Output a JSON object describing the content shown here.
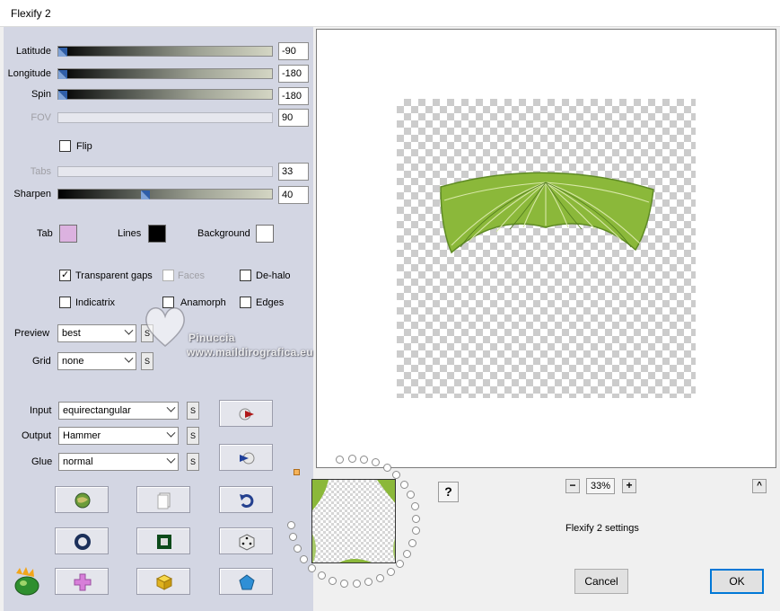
{
  "window": {
    "title": "Flexify 2"
  },
  "sliders": {
    "latitude": {
      "label": "Latitude",
      "value": "-90",
      "level": 0.0,
      "enabled": true
    },
    "longitude": {
      "label": "Longitude",
      "value": "-180",
      "level": 0.0,
      "enabled": true
    },
    "spin": {
      "label": "Spin",
      "value": "-180",
      "level": 0.0,
      "enabled": true
    },
    "fov": {
      "label": "FOV",
      "value": "90",
      "enabled": false
    },
    "tabs": {
      "label": "Tabs",
      "value": "33",
      "enabled": false
    },
    "sharpen": {
      "label": "Sharpen",
      "value": "40",
      "level": 0.4,
      "enabled": true
    }
  },
  "flip": {
    "label": "Flip",
    "checked": false
  },
  "colors": {
    "tab": {
      "label": "Tab",
      "color": "#dcb2e0"
    },
    "lines": {
      "label": "Lines",
      "color": "#000000"
    },
    "background": {
      "label": "Background",
      "color": "#ffffff"
    }
  },
  "options": {
    "transparent_gaps": {
      "label": "Transparent gaps",
      "checked": true,
      "enabled": true
    },
    "faces": {
      "label": "Faces",
      "checked": false,
      "enabled": false
    },
    "de_halo": {
      "label": "De-halo",
      "checked": false,
      "enabled": true
    },
    "indicatrix": {
      "label": "Indicatrix",
      "checked": false,
      "enabled": true
    },
    "anamorph": {
      "label": "Anamorph",
      "checked": false,
      "enabled": true
    },
    "edges": {
      "label": "Edges",
      "checked": false,
      "enabled": true
    }
  },
  "preview_select": {
    "label": "Preview",
    "value": "best",
    "s": "S"
  },
  "grid_select": {
    "label": "Grid",
    "value": "none",
    "s": "S"
  },
  "input_select": {
    "label": "Input",
    "value": "equirectangular",
    "s": "S"
  },
  "output_select": {
    "label": "Output",
    "value": "Hammer",
    "s": "S"
  },
  "glue_select": {
    "label": "Glue",
    "value": "normal",
    "s": "S"
  },
  "watermark": {
    "line1": "Pinuccia",
    "line2": "www.maildirografica.eu"
  },
  "zoom": {
    "minus": "−",
    "value": "33%",
    "plus": "+"
  },
  "help": {
    "label": "?"
  },
  "collapse": {
    "label": "^"
  },
  "settings_text": "Flexify 2 settings",
  "buttons": {
    "cancel": "Cancel",
    "ok": "OK"
  },
  "theme": {
    "panel": "#d3d6e3",
    "accent": "#0078d7",
    "thumb": "#2f5ea8",
    "leaf_green": "#8bb83a"
  }
}
